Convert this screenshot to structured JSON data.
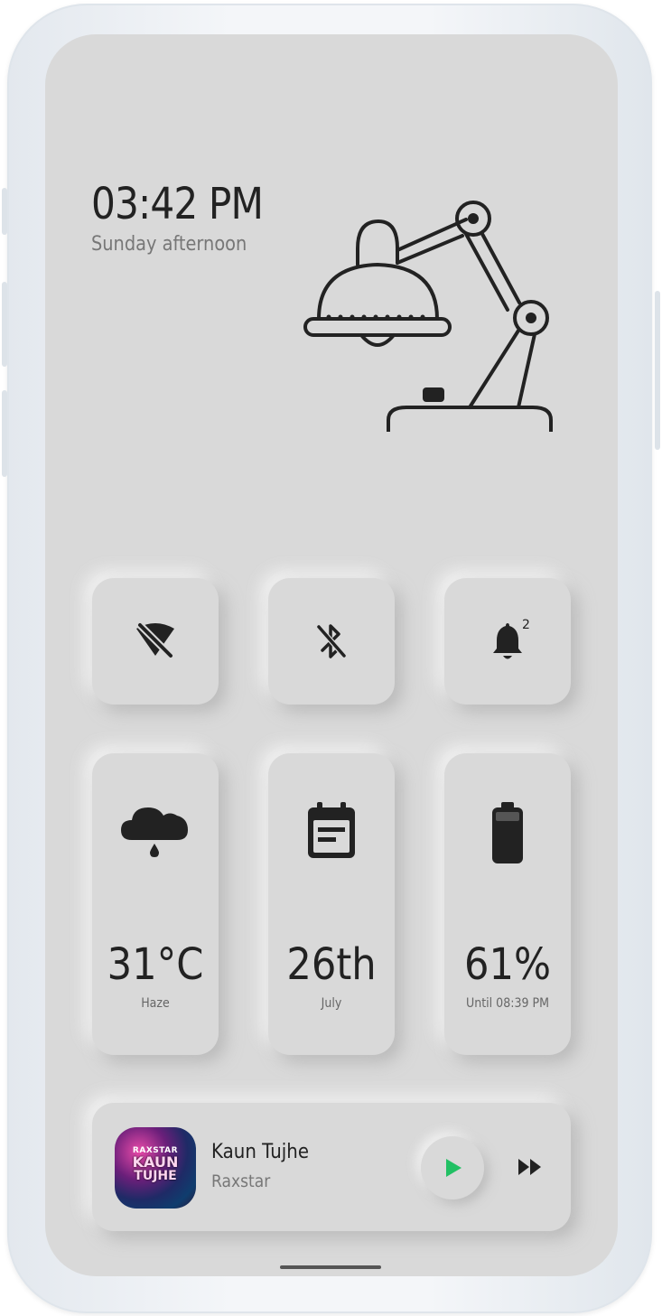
{
  "status": {
    "time": "03:42 PM",
    "period": "Sunday afternoon"
  },
  "quick_toggles": [
    {
      "name": "wifi-off",
      "icon": "wifi-off-icon"
    },
    {
      "name": "bluetooth-off",
      "icon": "bluetooth-off-icon"
    },
    {
      "name": "notifications",
      "icon": "bell-icon",
      "badge": "2"
    }
  ],
  "widgets": {
    "weather": {
      "icon": "rain-cloud-icon",
      "value": "31°C",
      "sub": "Haze"
    },
    "calendar": {
      "icon": "calendar-icon",
      "value": "26th",
      "sub": "July"
    },
    "battery": {
      "icon": "battery-icon",
      "value": "61%",
      "sub": "Until 08:39 PM"
    }
  },
  "player": {
    "album_art_text": [
      "RAXSTAR",
      "KAUN",
      "TUJHE"
    ],
    "title": "Kaun Tujhe",
    "artist": "Raxstar",
    "play_icon": "play-icon",
    "next_icon": "fast-forward-icon"
  },
  "colors": {
    "background": "#d9d9d9",
    "text": "#222222",
    "muted": "#777777",
    "play_accent": "#22c064"
  }
}
